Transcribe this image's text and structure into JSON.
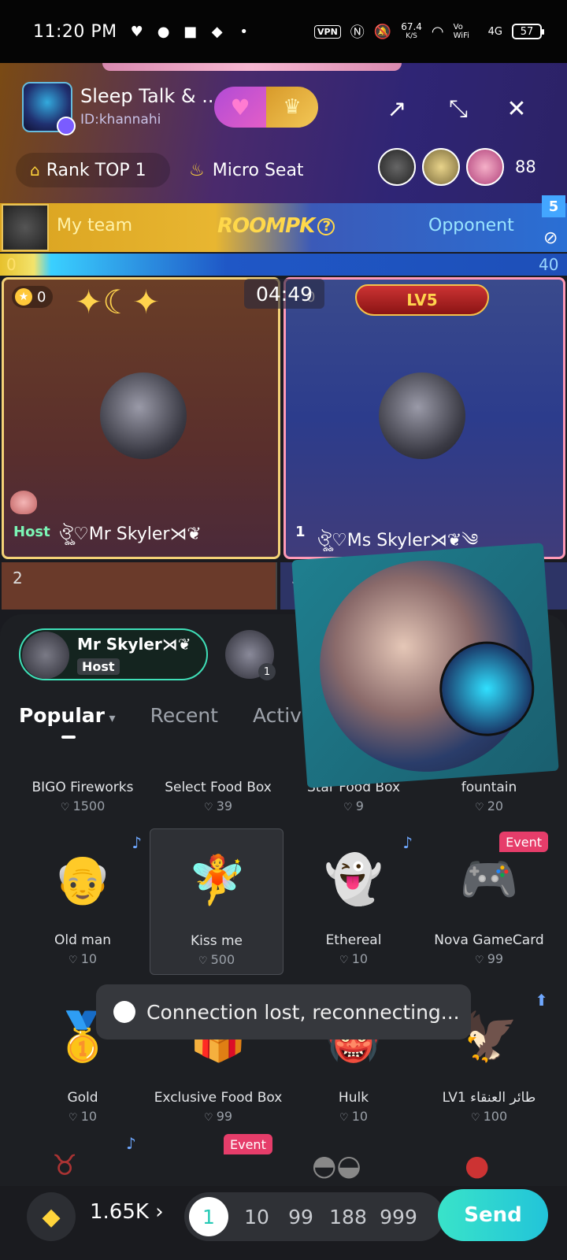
{
  "status_bar": {
    "time": "11:20 PM",
    "vpn": "VPN",
    "net_speed_value": "67.4",
    "net_speed_unit": "K/S",
    "volte": "Vo WiFi",
    "network": "4G",
    "battery": "57"
  },
  "room": {
    "title": "Sleep Talk & ...",
    "id": "ID:khannahi",
    "rank_label": "Rank TOP 1",
    "micro_seat_label": "Micro Seat",
    "viewer_count": "88"
  },
  "pk": {
    "my_team_label": "My team",
    "title": "ROOMPK",
    "opponent_label": "Opponent",
    "level_badge": "5",
    "my_score": "0",
    "opponent_score": "40",
    "timer": "04:49",
    "level_banner": "LV5"
  },
  "seats": {
    "left": {
      "coins": "0",
      "tag": "Host",
      "name": "ঔৣ♡Mr Skyler⋊❦"
    },
    "right": {
      "coins": "0",
      "tag": "1",
      "name": "ঔৣ♡Ms Skyler⋊❦༄"
    },
    "row2_left": "2",
    "row2_right": "3"
  },
  "gift_panel": {
    "selected_user_name": "Mr Skyler⋊❦",
    "selected_user_tag": "Host",
    "second_user_badge": "1",
    "tabs": [
      "Popular",
      "Recent",
      "Activity"
    ],
    "top_row": [
      {
        "name": "BIGO Fireworks",
        "price": "1500"
      },
      {
        "name": "Select Food Box",
        "price": "39"
      },
      {
        "name": "Star Food Box",
        "price": "9"
      },
      {
        "name": "fountain",
        "price": "20"
      }
    ],
    "row2": [
      {
        "name": "Old man",
        "price": "10"
      },
      {
        "name": "Kiss me",
        "price": "500"
      },
      {
        "name": "Ethereal",
        "price": "10"
      },
      {
        "name": "Nova GameCard",
        "price": "99",
        "badge": "Event"
      }
    ],
    "row3": [
      {
        "name": "Gold",
        "price": "10"
      },
      {
        "name": "Exclusive Food Box",
        "price": "99"
      },
      {
        "name": "Hulk",
        "price": "10"
      },
      {
        "name": "LV1 طائر العنقاء",
        "price": "100"
      }
    ],
    "row4_event_badge": "Event"
  },
  "toast": {
    "message": "Connection lost, reconnecting..."
  },
  "footer": {
    "balance": "1.65K",
    "quantities": [
      "1",
      "10",
      "99",
      "188",
      "999"
    ],
    "send_label": "Send"
  }
}
